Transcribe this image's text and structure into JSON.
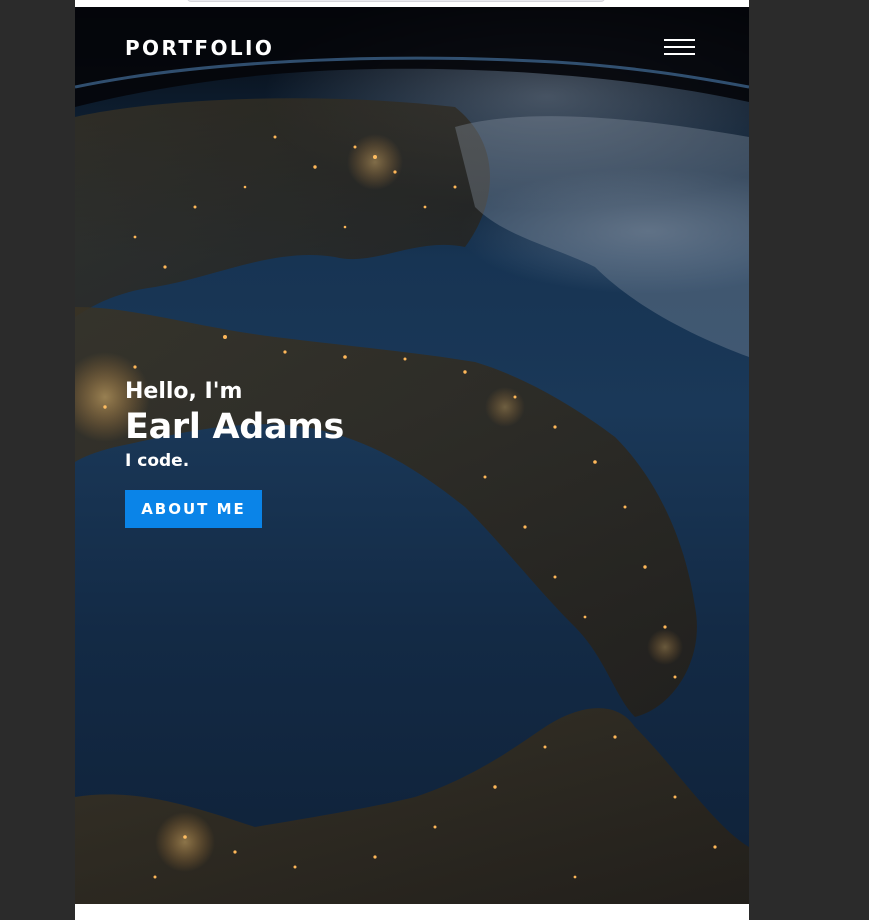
{
  "nav": {
    "brand": "PORTFOLIO",
    "menu_icon": "hamburger-menu-icon"
  },
  "hero": {
    "greeting": "Hello, I'm",
    "name": "Earl Adams",
    "tagline": "I code.",
    "cta_label": "ABOUT ME",
    "background": "earth-at-night-photo"
  },
  "colors": {
    "page_backdrop": "#2b2b2b",
    "accent": "#0a84e8",
    "text": "#ffffff"
  }
}
